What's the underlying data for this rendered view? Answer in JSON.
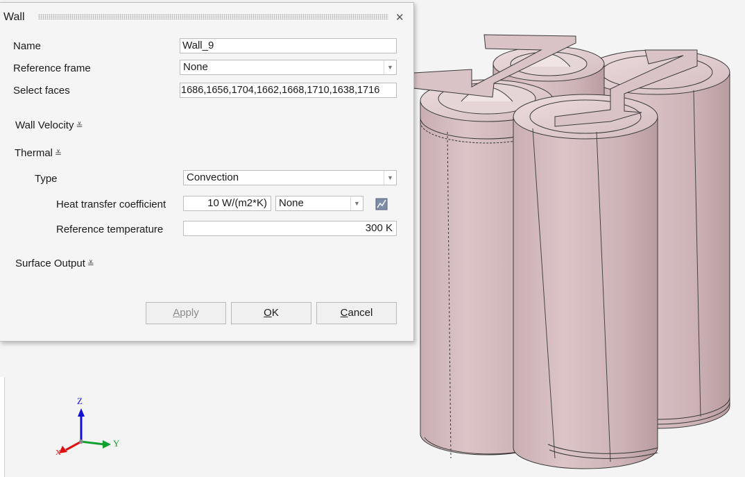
{
  "dialog": {
    "title": "Wall",
    "close_glyph": "✕",
    "fields": {
      "name_label": "Name",
      "name_value": "Wall_9",
      "ref_frame_label": "Reference frame",
      "ref_frame_value": "None",
      "select_faces_label": "Select faces",
      "select_faces_value": "1686,1656,1704,1662,1668,1710,1638,1716"
    },
    "sections": {
      "wall_velocity": "Wall Velocity",
      "thermal": "Thermal",
      "surface_output": "Surface Output",
      "chevron": "≚"
    },
    "thermal": {
      "type_label": "Type",
      "type_value": "Convection",
      "htc_label": "Heat transfer coefficient",
      "htc_value": "10 W/(m2*K)",
      "htc_curve_value": "None",
      "ref_temp_label": "Reference temperature",
      "ref_temp_value": "300 K",
      "curve_icon": "curve-editor-icon"
    },
    "buttons": {
      "apply_mnemonic": "A",
      "apply_rest": "pply",
      "ok_mnemonic": "O",
      "ok_rest": "K",
      "cancel_mnemonic": "C",
      "cancel_rest": "ancel"
    }
  },
  "axis_triad": {
    "z": "Z",
    "y": "Y",
    "x": "X"
  },
  "colors": {
    "cell_body": "#d8c0c3",
    "axis_z": "#1010d0",
    "axis_y": "#10a030",
    "axis_x": "#e01010"
  }
}
